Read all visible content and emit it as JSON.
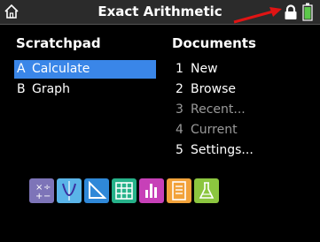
{
  "header": {
    "title": "Exact Arithmetic",
    "icons": [
      "home-icon",
      "lock-icon",
      "battery-icon"
    ],
    "annotation_arrow_color": "#e01414"
  },
  "scratchpad": {
    "heading": "Scratchpad",
    "items": [
      {
        "key": "A",
        "label": "Calculate",
        "selected": true
      },
      {
        "key": "B",
        "label": "Graph",
        "selected": false
      }
    ],
    "selection_color": "#3a86e8"
  },
  "documents": {
    "heading": "Documents",
    "items": [
      {
        "key": "1",
        "label": "New",
        "enabled": true
      },
      {
        "key": "2",
        "label": "Browse",
        "enabled": true
      },
      {
        "key": "3",
        "label": "Recent...",
        "enabled": false
      },
      {
        "key": "4",
        "label": "Current",
        "enabled": false
      },
      {
        "key": "5",
        "label": "Settings...",
        "enabled": true
      }
    ]
  },
  "app_icons": [
    {
      "name": "calculator-app-icon",
      "color": "#7d74b8"
    },
    {
      "name": "graphs-app-icon",
      "color": "#5ab4e8"
    },
    {
      "name": "geometry-app-icon",
      "color": "#2f88d8"
    },
    {
      "name": "lists-spreadsheet-app-icon",
      "color": "#26b28a"
    },
    {
      "name": "data-statistics-app-icon",
      "color": "#c740b8"
    },
    {
      "name": "notes-app-icon",
      "color": "#f2a23a"
    },
    {
      "name": "vernier-dataquest-app-icon",
      "color": "#8cc63f"
    }
  ]
}
